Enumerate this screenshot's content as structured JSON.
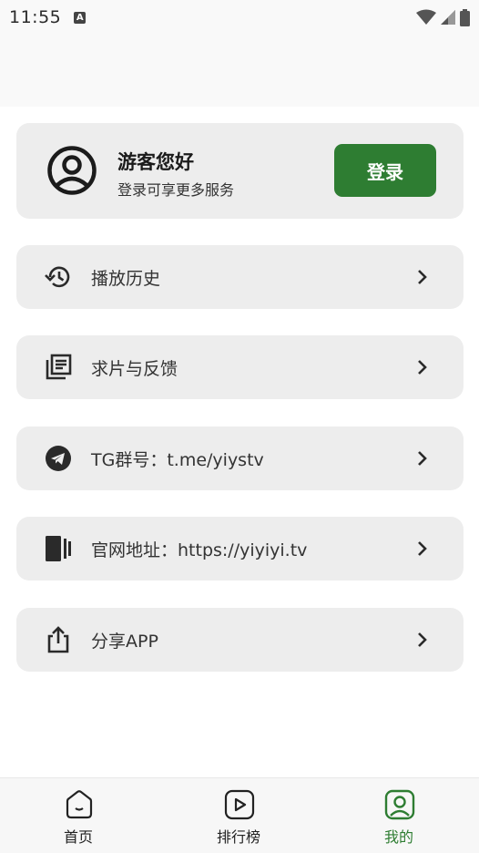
{
  "status_bar": {
    "time": "11:55",
    "notification_icon": "a-letter-icon",
    "right_icons": [
      "wifi-icon",
      "signal-icon",
      "battery-icon"
    ]
  },
  "user_card": {
    "greeting": "游客您好",
    "subtitle": "登录可享更多服务",
    "login_label": "登录",
    "avatar_icon": "account-circle-icon"
  },
  "menu": {
    "items": [
      {
        "label": "播放历史",
        "icon": "history-icon"
      },
      {
        "label": "求片与反馈",
        "icon": "library-books-icon"
      },
      {
        "label": "TG群号：t.me/yiystv",
        "icon": "telegram-icon"
      },
      {
        "label": "官网地址：https://yiyiyi.tv",
        "icon": "web-stories-icon"
      },
      {
        "label": "分享APP",
        "icon": "share-icon"
      }
    ]
  },
  "bottom_nav": {
    "tabs": [
      {
        "label": "首页",
        "icon": "home-icon",
        "active": false
      },
      {
        "label": "排行榜",
        "icon": "play-square-icon",
        "active": false
      },
      {
        "label": "我的",
        "icon": "user-square-icon",
        "active": true
      }
    ]
  },
  "colors": {
    "accent": "#2e7d32",
    "card_bg": "#ededed",
    "text": "#333333"
  }
}
